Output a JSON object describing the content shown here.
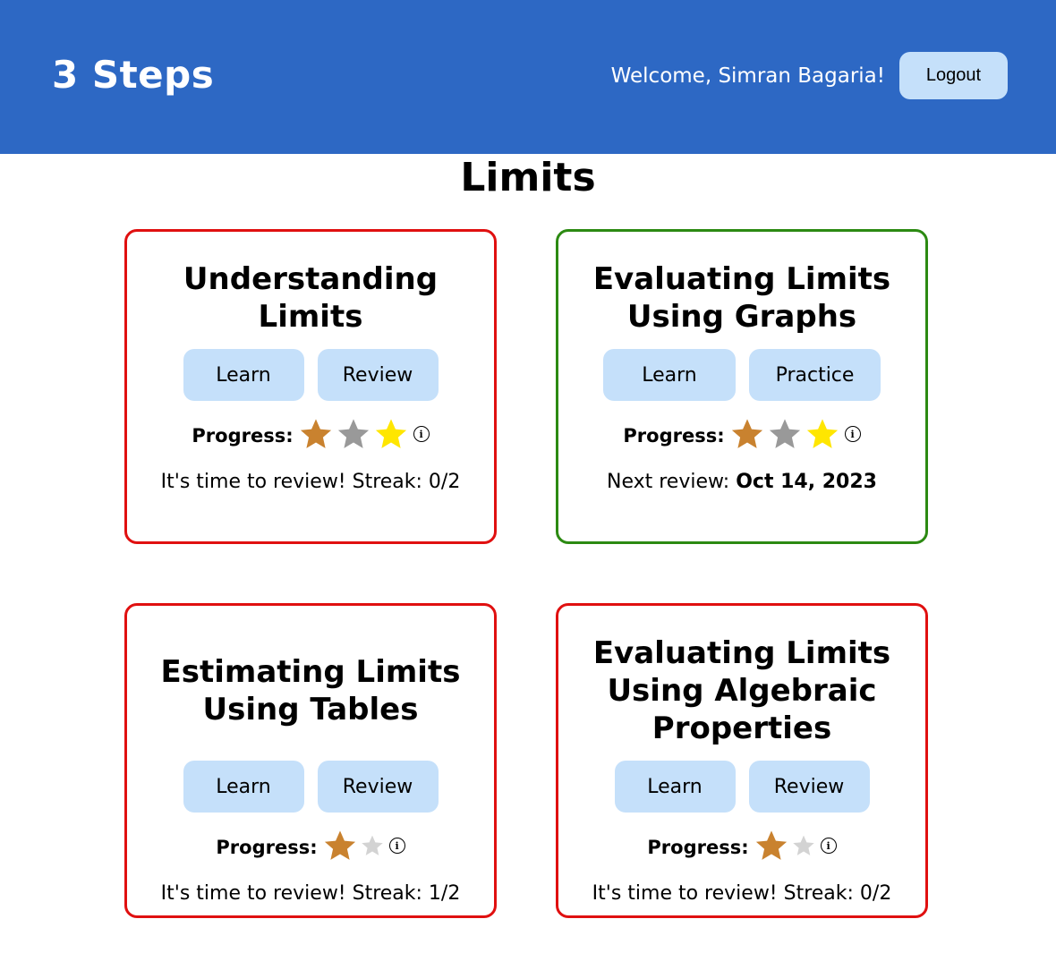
{
  "header": {
    "brand": "3 Steps",
    "welcome": "Welcome, Simran Bagaria!",
    "logout_label": "Logout",
    "background_color": "#2d68c4"
  },
  "page": {
    "title": "Limits"
  },
  "progress_label": "Progress:",
  "star_colors": {
    "bronze": "#c9822f",
    "silver": "#999999",
    "gold": "#ffe600",
    "empty": "#d3d3d3"
  },
  "cards": [
    {
      "title_lines": [
        "Understanding",
        "Limits"
      ],
      "border_color": "#e01010",
      "buttons": [
        "Learn",
        "Review"
      ],
      "stars": [
        "bronze",
        "silver",
        "gold"
      ],
      "status_prefix": "It's time to review! Streak: 0/2",
      "status_bold": ""
    },
    {
      "title_lines": [
        "Evaluating Limits",
        "Using Graphs"
      ],
      "border_color": "#2c8a12",
      "buttons": [
        "Learn",
        "Practice"
      ],
      "stars": [
        "bronze",
        "silver",
        "gold"
      ],
      "status_prefix": "Next review: ",
      "status_bold": "Oct 14, 2023"
    },
    {
      "title_lines": [
        "Estimating Limits",
        "Using Tables"
      ],
      "border_color": "#e01010",
      "buttons": [
        "Learn",
        "Review"
      ],
      "stars": [
        "bronze",
        "empty"
      ],
      "status_prefix": "It's time to review! Streak: 1/2",
      "status_bold": ""
    },
    {
      "title_lines": [
        "Evaluating Limits",
        "Using Algebraic",
        "Properties"
      ],
      "border_color": "#e01010",
      "buttons": [
        "Learn",
        "Review"
      ],
      "stars": [
        "bronze",
        "empty"
      ],
      "status_prefix": "It's time to review! Streak: 0/2",
      "status_bold": ""
    }
  ]
}
